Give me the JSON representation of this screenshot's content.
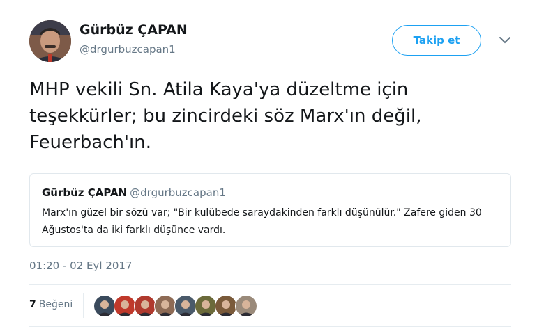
{
  "author": {
    "name": "Gürbüz ÇAPAN",
    "handle": "@drgurbuzcapan1",
    "avatar_icon": "user-avatar"
  },
  "follow_button": {
    "label": "Takip et",
    "color": "#1da1f2"
  },
  "menu_icon": "chevron-down-icon",
  "tweet": {
    "text": "MHP vekili Sn. Atila Kaya'ya düzeltme için teşekkürler; bu zincirdeki söz Marx'ın değil, Feuerbach'ın."
  },
  "quoted_tweet": {
    "name": "Gürbüz ÇAPAN",
    "handle": "@drgurbuzcapan1",
    "text": "Marx'ın güzel bir sözü var; \"Bir kulübede saraydakinden farklı düşünülür.\" Zafere giden 30 Ağustos'ta da iki farklı düşünce vardı."
  },
  "timestamp": "01:20 - 02 Eyl 2017",
  "likes": {
    "count": "7",
    "label": "Beğeni"
  },
  "likers": [
    {
      "name": "liker-avatar-1",
      "color": "#3a4a5c"
    },
    {
      "name": "liker-avatar-2",
      "color": "#c0392b"
    },
    {
      "name": "liker-avatar-3",
      "color": "#b03a2e"
    },
    {
      "name": "liker-avatar-4",
      "color": "#8e6b55"
    },
    {
      "name": "liker-avatar-5",
      "color": "#4a5a6a"
    },
    {
      "name": "liker-avatar-6",
      "color": "#6b6a3a"
    },
    {
      "name": "liker-avatar-7",
      "color": "#7a5a3a"
    },
    {
      "name": "liker-avatar-8",
      "color": "#9a8a7a"
    }
  ]
}
